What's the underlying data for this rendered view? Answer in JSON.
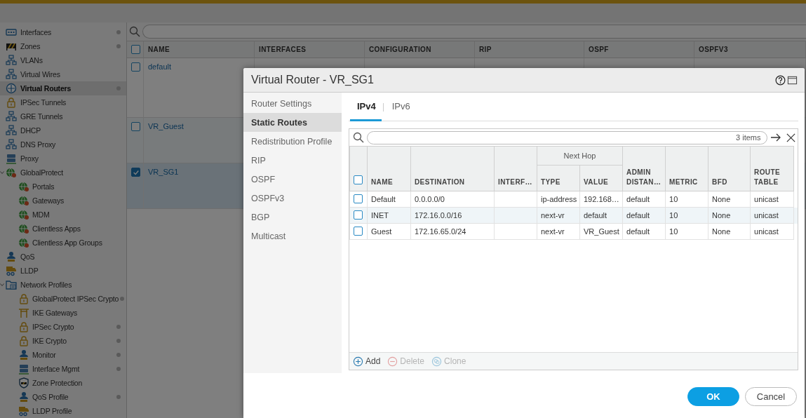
{
  "sidebar": {
    "items": [
      {
        "label": "Interfaces",
        "selected": false,
        "status_dot": true
      },
      {
        "label": "Zones",
        "selected": false,
        "status_dot": true
      },
      {
        "label": "VLANs",
        "selected": false,
        "status_dot": false
      },
      {
        "label": "Virtual Wires",
        "selected": false,
        "status_dot": false
      },
      {
        "label": "Virtual Routers",
        "selected": true,
        "status_dot": true
      },
      {
        "label": "IPSec Tunnels",
        "selected": false,
        "status_dot": false
      },
      {
        "label": "GRE Tunnels",
        "selected": false,
        "status_dot": false
      },
      {
        "label": "DHCP",
        "selected": false,
        "status_dot": false
      },
      {
        "label": "DNS Proxy",
        "selected": false,
        "status_dot": false
      },
      {
        "label": "Proxy",
        "selected": false,
        "status_dot": false
      },
      {
        "label": "GlobalProtect",
        "selected": false,
        "status_dot": false,
        "expanded": true,
        "children": [
          {
            "label": "Portals",
            "selected": false,
            "status_dot": false
          },
          {
            "label": "Gateways",
            "selected": false,
            "status_dot": false
          },
          {
            "label": "MDM",
            "selected": false,
            "status_dot": false
          },
          {
            "label": "Clientless Apps",
            "selected": false,
            "status_dot": false
          },
          {
            "label": "Clientless App Groups",
            "selected": false,
            "status_dot": false
          }
        ]
      },
      {
        "label": "QoS",
        "selected": false,
        "status_dot": false
      },
      {
        "label": "LLDP",
        "selected": false,
        "status_dot": false
      },
      {
        "label": "Network Profiles",
        "selected": false,
        "status_dot": false,
        "expanded": true,
        "children": [
          {
            "label": "GlobalProtect IPSec Crypto",
            "selected": false,
            "status_dot": true
          },
          {
            "label": "IKE Gateways",
            "selected": false,
            "status_dot": false
          },
          {
            "label": "IPSec Crypto",
            "selected": false,
            "status_dot": true
          },
          {
            "label": "IKE Crypto",
            "selected": false,
            "status_dot": true
          },
          {
            "label": "Monitor",
            "selected": false,
            "status_dot": true
          },
          {
            "label": "Interface Mgmt",
            "selected": false,
            "status_dot": true
          },
          {
            "label": "Zone Protection",
            "selected": false,
            "status_dot": false
          },
          {
            "label": "QoS Profile",
            "selected": false,
            "status_dot": true
          },
          {
            "label": "LLDP Profile",
            "selected": false,
            "status_dot": false
          }
        ]
      }
    ]
  },
  "table": {
    "columns": [
      "NAME",
      "INTERFACES",
      "CONFIGURATION",
      "RIP",
      "OSPF",
      "OSPFV3"
    ],
    "all_checked": false,
    "rows": [
      {
        "name": "default",
        "checked": false,
        "selected": false
      },
      {
        "name": "VR_Guest",
        "checked": false,
        "selected": false
      },
      {
        "name": "VR_SG1",
        "checked": true,
        "selected": true
      }
    ]
  },
  "dialog": {
    "title": "Virtual Router - VR_SG1",
    "nav": [
      {
        "label": "Router Settings",
        "selected": false
      },
      {
        "label": "Static Routes",
        "selected": true
      },
      {
        "label": "Redistribution Profile",
        "selected": false
      },
      {
        "label": "RIP",
        "selected": false
      },
      {
        "label": "OSPF",
        "selected": false
      },
      {
        "label": "OSPFv3",
        "selected": false
      },
      {
        "label": "BGP",
        "selected": false
      },
      {
        "label": "Multicast",
        "selected": false
      }
    ],
    "tabs": [
      {
        "label": "IPv4",
        "selected": true
      },
      {
        "label": "IPv6",
        "selected": false
      }
    ],
    "search": {
      "count": "3 items"
    },
    "table": {
      "columns": [
        {
          "label": "NAME"
        },
        {
          "label": "DESTINATION"
        },
        {
          "label": "INTERF…"
        },
        {
          "label": "Next Hop",
          "children": [
            "TYPE",
            "VALUE"
          ]
        },
        {
          "label": "ADMIN DISTAN…"
        },
        {
          "label": "METRIC"
        },
        {
          "label": "BFD"
        },
        {
          "label": "ROUTE TABLE"
        }
      ],
      "all_checked": false,
      "rows": [
        {
          "checked": false,
          "name": "Default",
          "destination": "0.0.0.0/0",
          "type": "ip-address",
          "value": "192.168…",
          "admin_distance": "default",
          "metric": "10",
          "bfd": "None",
          "route_table": "unicast"
        },
        {
          "checked": false,
          "name": "INET",
          "destination": "172.16.0.0/16",
          "type": "next-vr",
          "value": "default",
          "admin_distance": "default",
          "metric": "10",
          "bfd": "None",
          "route_table": "unicast"
        },
        {
          "checked": false,
          "name": "Guest",
          "destination": "172.16.65.0/24",
          "type": "next-vr",
          "value": "VR_Guest",
          "admin_distance": "default",
          "metric": "10",
          "bfd": "None",
          "route_table": "unicast"
        }
      ]
    },
    "toolbar": [
      {
        "label": "Add",
        "kind": "add",
        "disabled": false
      },
      {
        "label": "Delete",
        "kind": "delete",
        "disabled": true
      },
      {
        "label": "Clone",
        "kind": "clone",
        "disabled": true
      }
    ],
    "buttons": [
      {
        "label": "OK",
        "kind": "primary"
      },
      {
        "label": "Cancel",
        "kind": "secondary"
      }
    ]
  }
}
